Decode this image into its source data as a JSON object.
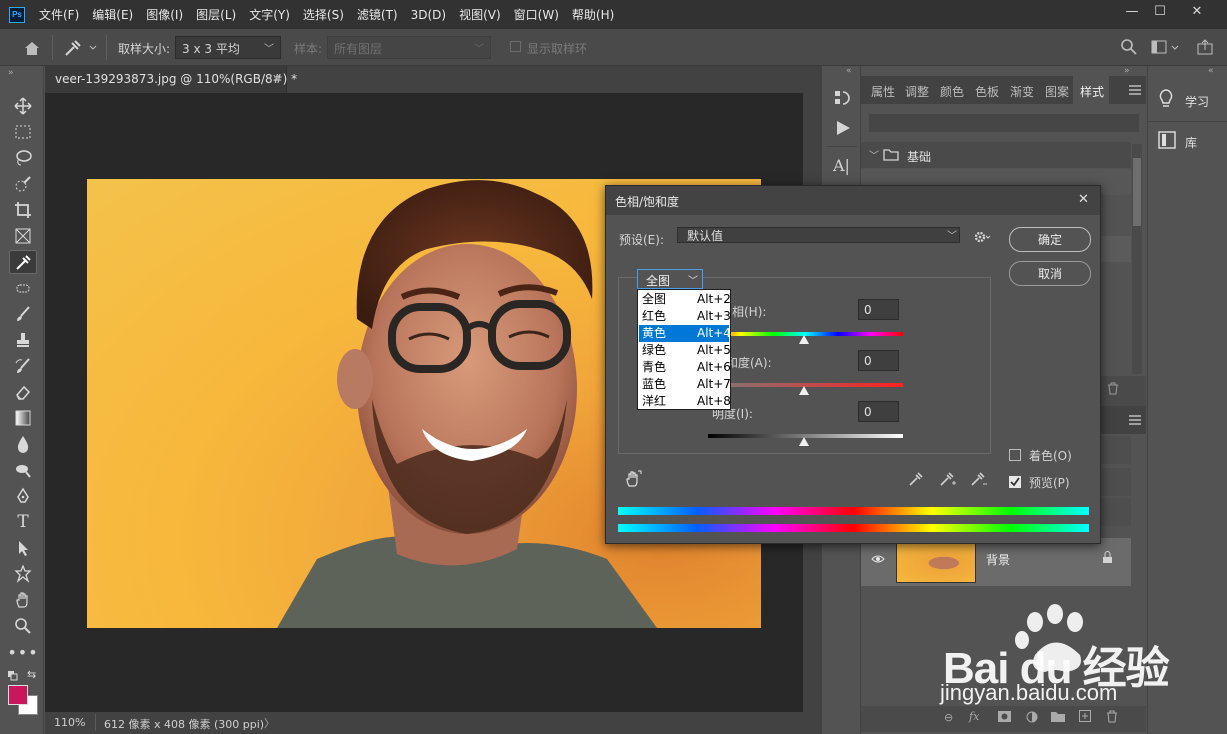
{
  "menubar": {
    "logo": "Ps",
    "items": [
      "文件(F)",
      "编辑(E)",
      "图像(I)",
      "图层(L)",
      "文字(Y)",
      "选择(S)",
      "滤镜(T)",
      "3D(D)",
      "视图(V)",
      "窗口(W)",
      "帮助(H)"
    ],
    "minimize": "—",
    "restore": "☐",
    "close": "✕"
  },
  "optbar": {
    "sample_size_label": "取样大小:",
    "sample_size_value": "3 x 3 平均",
    "sample_label": "样本:",
    "sample_value": "所有图层",
    "show_ring_label": "显示取样环"
  },
  "document": {
    "tab_title": "veer-139293873.jpg @ 110%(RGB/8#) *",
    "tab_close": "✕",
    "zoom": "110%",
    "size_info": "612 像素 x 408 像素 (300 ppi)",
    "status_arrow": "〉"
  },
  "panels": {
    "tabs": [
      "属性",
      "调整",
      "颜色",
      "色板",
      "渐变",
      "图案",
      "样式"
    ],
    "active_tab": "样式",
    "folder_label": "基础",
    "layer_name": "背景",
    "far_right": [
      {
        "label": "学习",
        "icon": "lightbulb-icon"
      },
      {
        "label": "库",
        "icon": "library-icon"
      }
    ]
  },
  "dialog": {
    "title": "色相/饱和度",
    "close": "✕",
    "preset_label": "预设(E):",
    "preset_value": "默认值",
    "ok": "确定",
    "cancel": "取消",
    "channel_value": "全图",
    "hue_label": "相(H):",
    "hue_value": "0",
    "saturation_label": "和度(A):",
    "saturation_value": "0",
    "lightness_label": "明度(I):",
    "lightness_value": "0",
    "colorize_label": "着色(O)",
    "colorize_checked": false,
    "preview_label": "预览(P)",
    "preview_checked": true
  },
  "dropdown": {
    "items": [
      {
        "label": "全图",
        "shortcut": "Alt+2"
      },
      {
        "label": "红色",
        "shortcut": "Alt+3"
      },
      {
        "label": "黄色",
        "shortcut": "Alt+4"
      },
      {
        "label": "绿色",
        "shortcut": "Alt+5"
      },
      {
        "label": "青色",
        "shortcut": "Alt+6"
      },
      {
        "label": "蓝色",
        "shortcut": "Alt+7"
      },
      {
        "label": "洋红",
        "shortcut": "Alt+8"
      }
    ],
    "selected": "黄色"
  },
  "colors": {
    "foreground": "#c8175a",
    "background": "#ffffff",
    "accent": "#0078d7"
  },
  "watermark": {
    "brand": "Bai du 经验",
    "url": "jingyan.baidu.com"
  }
}
